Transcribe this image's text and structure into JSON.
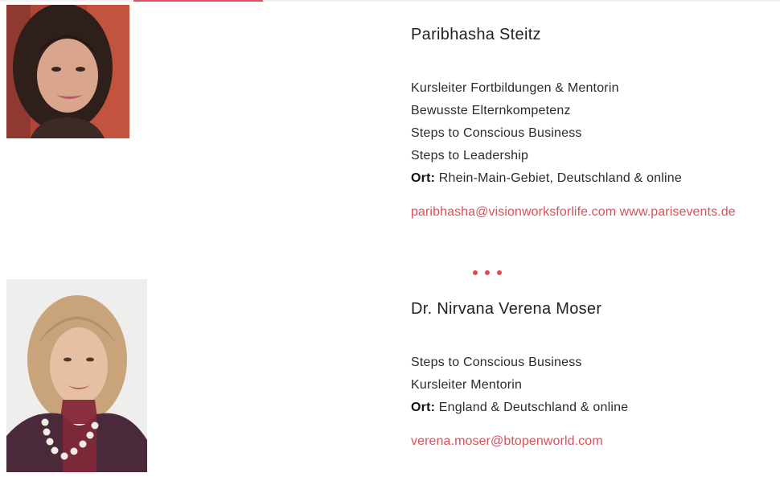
{
  "colors": {
    "accent": "#e0505a",
    "link": "#d9505a",
    "text": "#2b2b2b"
  },
  "people": [
    {
      "name": "Paribhasha Steitz",
      "roles": [
        "Kursleiter Fortbildungen & Mentorin",
        "Bewusste Elternkompetenz",
        "Steps to Conscious Business",
        "Steps to Leadership"
      ],
      "location_label": "Ort:",
      "location": "Rhein-Main-Gebiet, Deutschland & online",
      "email": "paribhasha@visionworksforlife.com",
      "website": "www.parisevents.de"
    },
    {
      "name": "Dr. Nirvana Verena Moser",
      "roles": [
        "Steps to Conscious Business",
        "Kursleiter Mentorin"
      ],
      "location_label": "Ort:",
      "location": "England & Deutschland & online",
      "email": "verena.moser@btopenworld.com"
    }
  ],
  "separator_icon": "three-dots-icon"
}
